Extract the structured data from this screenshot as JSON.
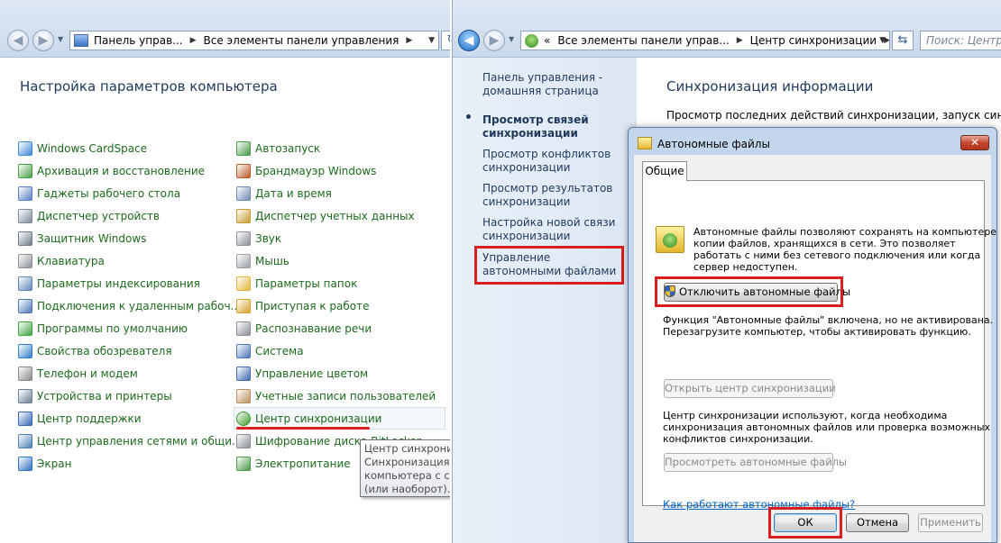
{
  "left_window": {
    "breadcrumb": [
      "Панель управ...",
      "Все элементы панели управления"
    ],
    "page_title": "Настройка параметров компьютера",
    "col1": [
      {
        "label": "Windows CardSpace",
        "icon": "cardspace-icon",
        "color": "#3f8ad6"
      },
      {
        "label": "Архивация и восстановление",
        "icon": "backup-icon",
        "color": "#4aa148"
      },
      {
        "label": "Гаджеты рабочего стола",
        "icon": "gadgets-icon",
        "color": "#5a7fc4"
      },
      {
        "label": "Диспетчер устройств",
        "icon": "device-manager-icon",
        "color": "#7d8a99"
      },
      {
        "label": "Защитник Windows",
        "icon": "defender-icon",
        "color": "#6c7a8a"
      },
      {
        "label": "Клавиатура",
        "icon": "keyboard-icon",
        "color": "#8a8f96"
      },
      {
        "label": "Параметры индексирования",
        "icon": "indexing-icon",
        "color": "#5f86b8"
      },
      {
        "label": "Подключения к удаленным рабоч...",
        "icon": "remoteapp-icon",
        "color": "#4c78b5"
      },
      {
        "label": "Программы по умолчанию",
        "icon": "default-programs-icon",
        "color": "#3fa43f"
      },
      {
        "label": "Свойства обозревателя",
        "icon": "internet-options-icon",
        "color": "#2f7fc8"
      },
      {
        "label": "Телефон и модем",
        "icon": "phone-modem-icon",
        "color": "#8a8a8a"
      },
      {
        "label": "Устройства и принтеры",
        "icon": "printers-icon",
        "color": "#6b7f95"
      },
      {
        "label": "Центр поддержки",
        "icon": "action-center-flag-icon",
        "color": "#3566b8"
      },
      {
        "label": "Центр управления сетями и общи...",
        "icon": "network-center-icon",
        "color": "#4b7fb8"
      },
      {
        "label": "Экран",
        "icon": "display-icon",
        "color": "#2e6fc2"
      }
    ],
    "col2": [
      {
        "label": "Автозапуск",
        "icon": "autoplay-icon",
        "color": "#4a9a4a"
      },
      {
        "label": "Брандмауэр Windows",
        "icon": "firewall-icon",
        "color": "#b65a2c"
      },
      {
        "label": "Дата и время",
        "icon": "date-time-icon",
        "color": "#6e8bb5"
      },
      {
        "label": "Диспетчер учетных данных",
        "icon": "credential-manager-icon",
        "color": "#c59a2e"
      },
      {
        "label": "Звук",
        "icon": "sound-icon",
        "color": "#8a8f98"
      },
      {
        "label": "Мышь",
        "icon": "mouse-icon",
        "color": "#9aa0a6"
      },
      {
        "label": "Параметры папок",
        "icon": "folder-options-icon",
        "color": "#e2b43a"
      },
      {
        "label": "Приступая к работе",
        "icon": "getting-started-icon",
        "color": "#d5a22c"
      },
      {
        "label": "Распознавание речи",
        "icon": "speech-icon",
        "color": "#8a8f96"
      },
      {
        "label": "Система",
        "icon": "system-icon",
        "color": "#4c78b5"
      },
      {
        "label": "Управление цветом",
        "icon": "color-management-icon",
        "color": "#3f6db0"
      },
      {
        "label": "Учетные записи пользователей",
        "icon": "user-accounts-icon",
        "color": "#b89060"
      },
      {
        "label": "Центр синхронизации",
        "icon": "sync-center-icon",
        "color": "#3b9a2b"
      },
      {
        "label": "Шифрование диска BitLocker",
        "icon": "bitlocker-icon",
        "color": "#8a8f96"
      },
      {
        "label": "Электропитание",
        "icon": "power-options-icon",
        "color": "#4a9a4a"
      }
    ],
    "tooltip": [
      "Центр синхрониз",
      "Синхронизация ф",
      "компьютера с сет",
      "(или наоборот)."
    ]
  },
  "right_window": {
    "breadcrumb": [
      "«",
      "Все элементы панели управ...",
      "Центр синхронизации"
    ],
    "search_placeholder": "Поиск: Центр с",
    "side_links": [
      "Панель управления - домашняя страница",
      "Просмотр связей синхронизации",
      "Просмотр конфликтов синхронизации",
      "Просмотр результатов синхронизации",
      "Настройка новой связи синхронизации",
      "Управление автономными файлами"
    ],
    "page_title": "Синхронизация информации",
    "page_desc": "Просмотр последних действий синхронизации, запуск синхрониза"
  },
  "dialog": {
    "title": "Автономные файлы",
    "close_label": "✕",
    "tab_general": "Общие",
    "intro": [
      "Автономные файлы позволяют сохранять на компьютере",
      "копии файлов, хранящихся в сети.  Это позволяет",
      "работать с ними без сетевого подключения или когда",
      "сервер недоступен."
    ],
    "disable_button": "Отключить автономные файлы",
    "status": [
      "Функция \"Автономные файлы\" включена, но не активирована.",
      "Перезагрузите компьютер, чтобы активировать функцию."
    ],
    "open_sync_button": "Открыть центр синхронизации",
    "sync_text": [
      "Центр синхронизации используют, когда необходима",
      "синхронизация автономных файлов или проверка возможных",
      "конфликтов синхронизации."
    ],
    "view_files_button": "Просмотреть автономные файлы",
    "help_link": "Как работают автономные файлы?",
    "ok": "ОК",
    "cancel": "Отмена",
    "apply": "Применить"
  },
  "colors": {
    "highlight_red": "#d81e1e",
    "link_green": "#1d6a1d",
    "title_blue": "#1e395b",
    "hyperlink": "#0066cc"
  }
}
